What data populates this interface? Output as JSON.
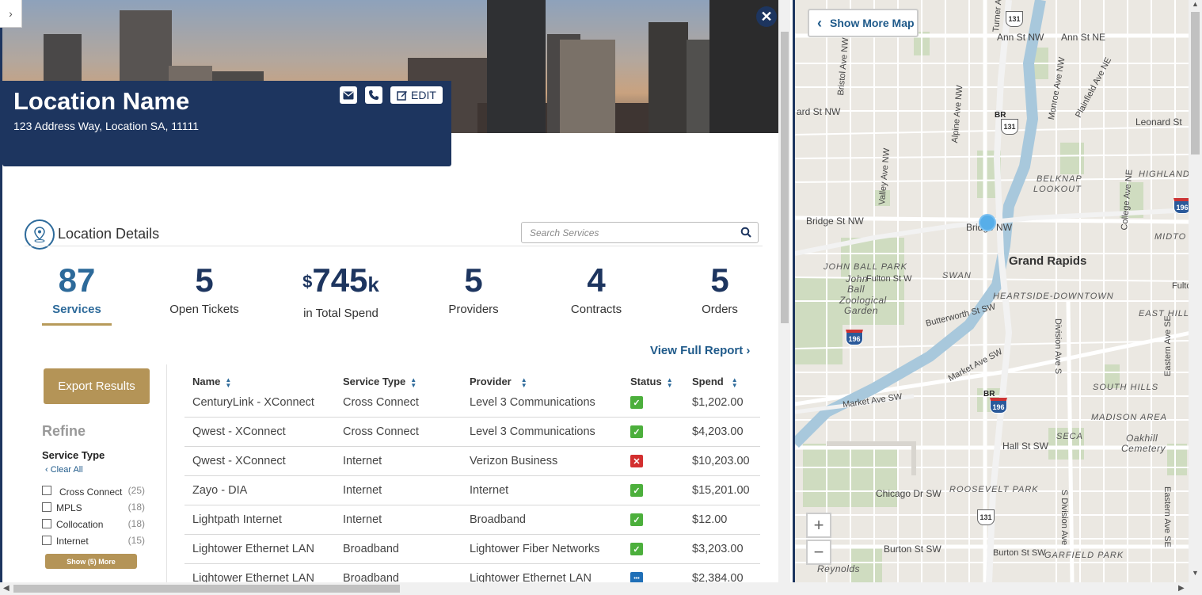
{
  "header": {
    "location_name": "Location Name",
    "address": "123 Address Way, Location SA, 11111",
    "edit_label": "EDIT",
    "close_glyph": "✕"
  },
  "section": {
    "title": "Location Details",
    "search_placeholder": "Search Services"
  },
  "stats": [
    {
      "value": "87",
      "label": "Services"
    },
    {
      "value": "5",
      "label": "Open Tickets"
    },
    {
      "currency": "$",
      "value": "745",
      "unit": "k",
      "label": "in Total Spend"
    },
    {
      "value": "5",
      "label": "Providers"
    },
    {
      "value": "4",
      "label": "Contracts"
    },
    {
      "value": "5",
      "label": "Orders"
    }
  ],
  "view_report_label": "View Full Report",
  "sidebar": {
    "export_label": "Export Results",
    "refine_label": "Refine",
    "filter_title": "Service Type",
    "clear_all_label": "Clear All",
    "filters": [
      {
        "label": "Cross Connect",
        "count": "(25)"
      },
      {
        "label": "MPLS",
        "count": "(18)"
      },
      {
        "label": "Collocation",
        "count": "(18)"
      },
      {
        "label": "Internet",
        "count": "(15)"
      }
    ],
    "show_more_label": "Show (5) More"
  },
  "table": {
    "columns": [
      "Name",
      "Service Type",
      "Provider",
      "Status",
      "Spend"
    ],
    "rows": [
      {
        "name": "CenturyLink - XConnect",
        "type": "Cross Connect",
        "provider": "Level 3 Communications",
        "status": "ok",
        "spend": "$1,202.00"
      },
      {
        "name": "Qwest - XConnect",
        "type": "Cross Connect",
        "provider": "Level 3 Communications",
        "status": "ok",
        "spend": "$4,203.00"
      },
      {
        "name": "Qwest - XConnect",
        "type": "Internet",
        "provider": "Verizon Business",
        "status": "bad",
        "spend": "$10,203.00"
      },
      {
        "name": "Zayo - DIA",
        "type": "Internet",
        "provider": "Internet",
        "status": "ok",
        "spend": "$15,201.00"
      },
      {
        "name": "Lightpath Internet",
        "type": "Internet",
        "provider": "Broadband",
        "status": "ok",
        "spend": "$12.00"
      },
      {
        "name": "Lightower Ethernet LAN",
        "type": "Broadband",
        "provider": "Lightower Fiber Networks",
        "status": "ok",
        "spend": "$3,203.00"
      },
      {
        "name": "Lightower Ethernet LAN",
        "type": "Broadband",
        "provider": "Lightower Ethernet LAN",
        "status": "pending",
        "spend": "$2,384.00"
      }
    ]
  },
  "map": {
    "show_more_label": "Show More Map",
    "zoom_in": "+",
    "zoom_out": "−",
    "labels": {
      "ann_st_nw": "Ann St NW",
      "ann_st_ne": "Ann St NE",
      "leonard_st_nw": "ard St NW",
      "leonard_st": "Leonard St",
      "bridge_st_nw": "Bridge St NW",
      "bridge_nw": "Bridge NW",
      "grand_rapids": "Grand Rapids",
      "john_ball_park": "JOHN BALL PARK",
      "swan": "SWAN",
      "heartside": "HEARTSIDE-DOWNTOWN",
      "east_hills": "EAST HILLS",
      "south_hills": "SOUTH HILLS",
      "madison_area": "MADISON AREA",
      "seca": "SECA",
      "roosevelt_park": "ROOSEVELT PARK",
      "garfield_park": "GARFIELD PARK",
      "belknap": "BELKNAP",
      "lookout": "LOOKOUT",
      "highland": "HIGHLAND",
      "midtown": "MIDTO",
      "hall_st_sw": "Hall St SW",
      "chicago_dr_sw": "Chicago Dr SW",
      "burton_st_sw": "Burton St SW",
      "burton_st_sw2": "Burton St SW",
      "market_ave_sw": "Market Ave SW",
      "butterworth": "Butterworth St SW",
      "fulton_st_w": "Fulton St W",
      "zoo1": "John",
      "zoo2": "Ball",
      "zoo3": "Zoological",
      "zoo4": "Garden",
      "oakhill1": "Oakhill",
      "oakhill2": "Cemetery",
      "reynolds": "Reynolds",
      "fulto": "Fulto",
      "bristol": "Bristol Ave NW",
      "alpine": "Alpine Ave NW",
      "valley": "Valley Ave NW",
      "monroe": "Monroe Ave NW",
      "plainfield": "Plainfield Ave NE",
      "college": "College Ave NE",
      "division": "Division Ave S",
      "s_division": "S Division Ave",
      "eastern": "Eastern Ave SE",
      "eastern2": "Eastern Ave SE",
      "turner": "Turner Av",
      "market_ave_sw2": "Market Ave SW",
      "shield_131a": "131",
      "shield_131b": "131",
      "shield_131c": "131",
      "shield_196a": "196",
      "shield_196b": "196",
      "shield_196c": "196",
      "br": "BR",
      "br2": "BR"
    }
  }
}
